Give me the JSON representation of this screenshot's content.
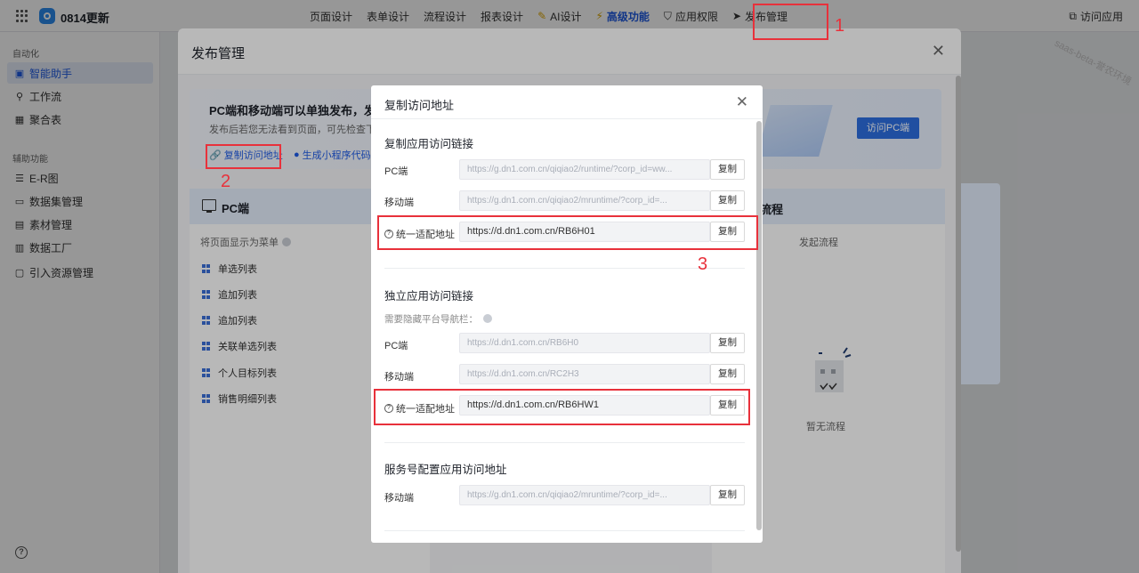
{
  "topbar": {
    "app_name": "0814更新",
    "nav": [
      {
        "label": "页面设计"
      },
      {
        "label": "表单设计"
      },
      {
        "label": "流程设计"
      },
      {
        "label": "报表设计"
      },
      {
        "label": "AI设计",
        "icon": "magic-wand-icon"
      },
      {
        "label": "高级功能",
        "icon": "lightning-icon"
      },
      {
        "label": "应用权限",
        "icon": "shield-icon"
      },
      {
        "label": "发布管理",
        "icon": "send-icon"
      }
    ],
    "visit_app": "访问应用",
    "watermark": "saas-beta-誉农环境"
  },
  "sidebar": {
    "group1": "自动化",
    "group1_items": [
      {
        "label": "智能助手",
        "icon": "assistant-icon",
        "active": true
      },
      {
        "label": "工作流",
        "icon": "workflow-icon"
      },
      {
        "label": "聚合表",
        "icon": "table-icon"
      }
    ],
    "group2": "辅助功能",
    "group2_items": [
      {
        "label": "E-R图",
        "icon": "er-diagram-icon"
      },
      {
        "label": "数据集管理",
        "icon": "dataset-icon"
      },
      {
        "label": "素材管理",
        "icon": "image-icon"
      },
      {
        "label": "数据工厂",
        "icon": "factory-icon"
      },
      {
        "label": "引入资源管理",
        "icon": "folder-icon"
      }
    ]
  },
  "publish": {
    "title": "发布管理",
    "banner_title": "PC端和移动端可以单独发布，发布后",
    "banner_desc": "发布后若您无法看到页面，可先检查下是",
    "copy_link": "复制访问地址",
    "miniapp_link": "生成小程序代码",
    "visit_pc": "访问PC端",
    "pc_col": {
      "title": "PC端",
      "sub": "将页面显示为菜单",
      "items": [
        "单选列表",
        "追加列表",
        "追加列表",
        "关联单选列表",
        "个人目标列表",
        "销售明细列表"
      ]
    },
    "flow_col": {
      "title": "流程",
      "sub": "发起流程",
      "empty": "暂无流程"
    }
  },
  "annotations": [
    "1",
    "2",
    "3"
  ],
  "modal": {
    "title": "复制访问地址",
    "sections": [
      {
        "title": "复制应用访问链接",
        "rows": [
          {
            "label": "PC端",
            "value": "https://g.dn1.com.cn/qiqiao2/runtime/?corp_id=ww...",
            "copy": "复制"
          },
          {
            "label": "移动端",
            "value": "https://g.dn1.com.cn/qiqiao2/mruntime/?corp_id=...",
            "copy": "复制"
          },
          {
            "label": "统一适配地址",
            "value": "https://d.dn1.com.cn/RB6H01",
            "copy": "复制"
          }
        ]
      },
      {
        "title": "独立应用访问链接",
        "hint": "需要隐藏平台导航栏：",
        "rows": [
          {
            "label": "PC端",
            "value": "https://d.dn1.com.cn/RB6H0",
            "copy": "复制"
          },
          {
            "label": "移动端",
            "value": "https://d.dn1.com.cn/RC2H3",
            "copy": "复制"
          },
          {
            "label": "统一适配地址",
            "value": "https://d.dn1.com.cn/RB6HW1",
            "copy": "复制"
          }
        ]
      },
      {
        "title": "服务号配置应用访问地址",
        "rows": [
          {
            "label": "移动端",
            "value": "https://g.dn1.com.cn/qiqiao2/mruntime/?corp_id=...",
            "copy": "复制"
          }
        ]
      }
    ]
  },
  "colors": {
    "accent": "#1e5be6",
    "annotation": "#e8313b"
  }
}
